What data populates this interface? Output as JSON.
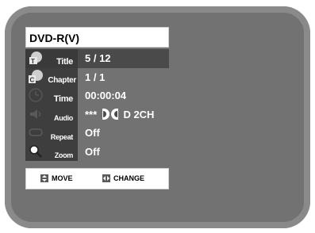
{
  "header": {
    "title": "DVD-R(V)"
  },
  "menu": {
    "items": [
      {
        "label": "Title",
        "value": "5 / 12",
        "icon": "title-icon",
        "selected": true
      },
      {
        "label": "Chapter",
        "value": "1 / 1",
        "icon": "chapter-icon",
        "selected": false
      },
      {
        "label": "Time",
        "value": "00:00:04",
        "icon": "clock-icon",
        "selected": false
      },
      {
        "label": "Audio",
        "value_prefix": "***",
        "value_suffix": "D 2CH",
        "icon": "speaker-icon",
        "selected": false
      },
      {
        "label": "Repeat",
        "value": "Off",
        "icon": "repeat-icon",
        "selected": false
      },
      {
        "label": "Zoom",
        "value": "Off",
        "icon": "zoom-icon",
        "selected": false
      }
    ]
  },
  "footer": {
    "move_label": "MOVE",
    "change_label": "CHANGE"
  },
  "colors": {
    "screen": "#6b6b6b",
    "panel": "#3e3e3e",
    "selected": "#4a4a4a",
    "text": "#ffffff"
  }
}
